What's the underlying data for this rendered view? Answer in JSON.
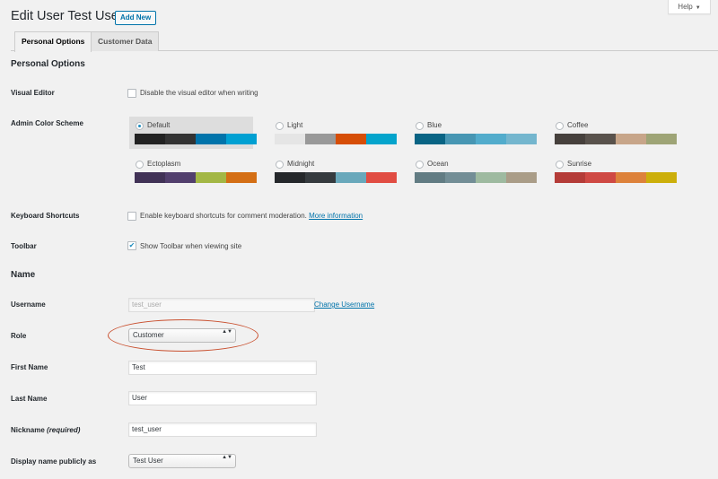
{
  "header": {
    "title": "Edit User Test User",
    "add_new_label": "Add New",
    "help_label": "Help",
    "help_caret": "▼"
  },
  "tabs": [
    {
      "label": "Personal Options",
      "active": true
    },
    {
      "label": "Customer Data",
      "active": false
    }
  ],
  "personal_options": {
    "heading": "Personal Options",
    "visual_editor": {
      "label": "Visual Editor",
      "option": "Disable the visual editor when writing",
      "checked": false
    },
    "admin_color_scheme": {
      "label": "Admin Color Scheme",
      "selected": "Default",
      "schemes": [
        {
          "name": "Default",
          "colors": [
            "#222222",
            "#333333",
            "#0073aa",
            "#00a0d2"
          ]
        },
        {
          "name": "Light",
          "colors": [
            "#e5e5e5",
            "#999999",
            "#d64e07",
            "#04a4cc"
          ]
        },
        {
          "name": "Blue",
          "colors": [
            "#096484",
            "#4796b3",
            "#52accc",
            "#74b6ce"
          ]
        },
        {
          "name": "Coffee",
          "colors": [
            "#46403c",
            "#59524c",
            "#c7a589",
            "#9ea476"
          ]
        },
        {
          "name": "Ectoplasm",
          "colors": [
            "#413256",
            "#523f6d",
            "#a3b745",
            "#d46f15"
          ]
        },
        {
          "name": "Midnight",
          "colors": [
            "#25282b",
            "#363b3f",
            "#69a8bb",
            "#e14d43"
          ]
        },
        {
          "name": "Ocean",
          "colors": [
            "#627c83",
            "#738e96",
            "#9ebaa0",
            "#aa9d88"
          ]
        },
        {
          "name": "Sunrise",
          "colors": [
            "#b43c38",
            "#cf4944",
            "#dd823b",
            "#ccaf0b"
          ]
        }
      ]
    },
    "keyboard_shortcuts": {
      "label": "Keyboard Shortcuts",
      "option": "Enable keyboard shortcuts for comment moderation.",
      "link": "More information",
      "checked": false
    },
    "toolbar": {
      "label": "Toolbar",
      "option": "Show Toolbar when viewing site",
      "checked": true
    }
  },
  "name_section": {
    "heading": "Name",
    "username": {
      "label": "Username",
      "value": "test_user",
      "link": "Change Username"
    },
    "role": {
      "label": "Role",
      "value": "Customer"
    },
    "first_name": {
      "label": "First Name",
      "value": "Test"
    },
    "last_name": {
      "label": "Last Name",
      "value": "User"
    },
    "nickname": {
      "label": "Nickname",
      "required": "(required)",
      "value": "test_user"
    },
    "display_name": {
      "label": "Display name publicly as",
      "value": "Test User"
    }
  },
  "select_arrows": "▲▼",
  "check_glyph": "✔",
  "annotation_color": "#c9502f"
}
